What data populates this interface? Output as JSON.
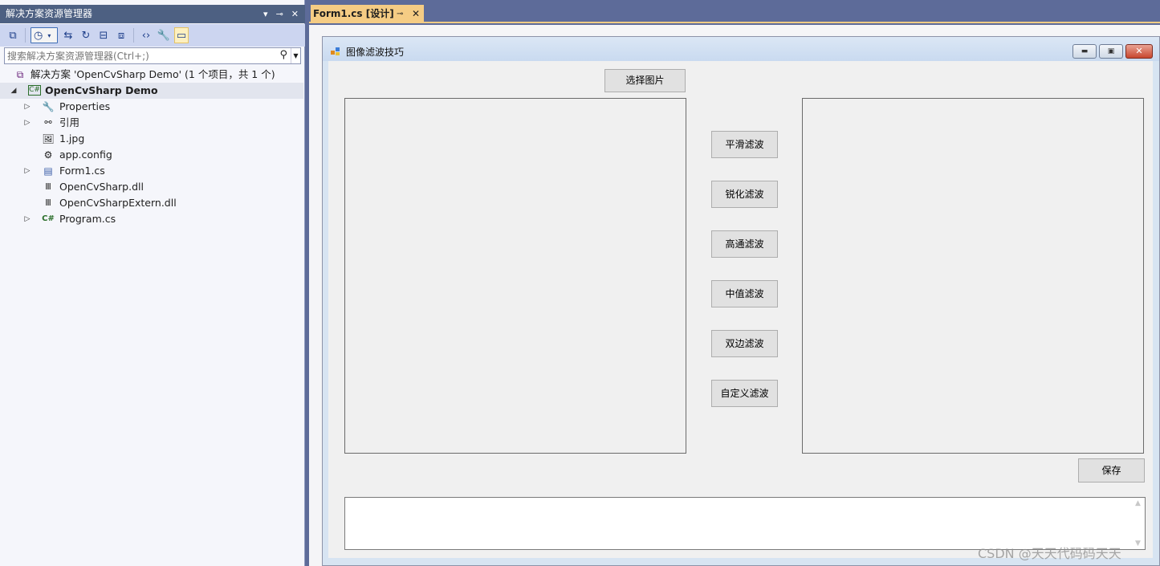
{
  "solution_explorer": {
    "title": "解决方案资源管理器",
    "title_icons": [
      "dropdown-arrow-icon",
      "pin-icon",
      "close-icon"
    ],
    "toolbar_icons": [
      "vs-switch-views-icon",
      "history-icon",
      "sync-icon",
      "refresh-icon",
      "collapse-all-icon",
      "show-all-files-icon",
      "view-code-icon",
      "properties-icon",
      "preview-selected-icon"
    ],
    "search_placeholder": "搜索解决方案资源管理器(Ctrl+;)",
    "solution_label": "解决方案 'OpenCvSharp Demo' (1 个项目，共 1 个)",
    "project_label": "OpenCvSharp Demo",
    "items": [
      {
        "label": "Properties",
        "icon": "wrench-icon",
        "expandable": true
      },
      {
        "label": "引用",
        "icon": "references-icon",
        "expandable": true
      },
      {
        "label": "1.jpg",
        "icon": "image-file-icon",
        "expandable": false
      },
      {
        "label": "app.config",
        "icon": "config-file-icon",
        "expandable": false
      },
      {
        "label": "Form1.cs",
        "icon": "form-icon",
        "expandable": true
      },
      {
        "label": "OpenCvSharp.dll",
        "icon": "library-icon",
        "expandable": false
      },
      {
        "label": "OpenCvSharpExtern.dll",
        "icon": "library-icon",
        "expandable": false
      },
      {
        "label": "Program.cs",
        "icon": "csharp-file-icon",
        "expandable": true
      }
    ]
  },
  "editor": {
    "tab_label": "Form1.cs [设计]",
    "tab_pin": "⊸",
    "tab_close": "✕"
  },
  "form": {
    "title": "图像滤波技巧",
    "select_button": "选择图片",
    "filter_buttons": [
      "平滑滤波",
      "锐化滤波",
      "高通滤波",
      "中值滤波",
      "双边滤波",
      "自定义滤波"
    ],
    "save_button": "保存",
    "log_text": ""
  },
  "watermark": "CSDN @天天代码码天天",
  "colors": {
    "chrome_blue": "#5d6b99",
    "title_bar": "#4d6082",
    "active_tab": "#f5cc84",
    "form_client": "#f0f0f0"
  }
}
